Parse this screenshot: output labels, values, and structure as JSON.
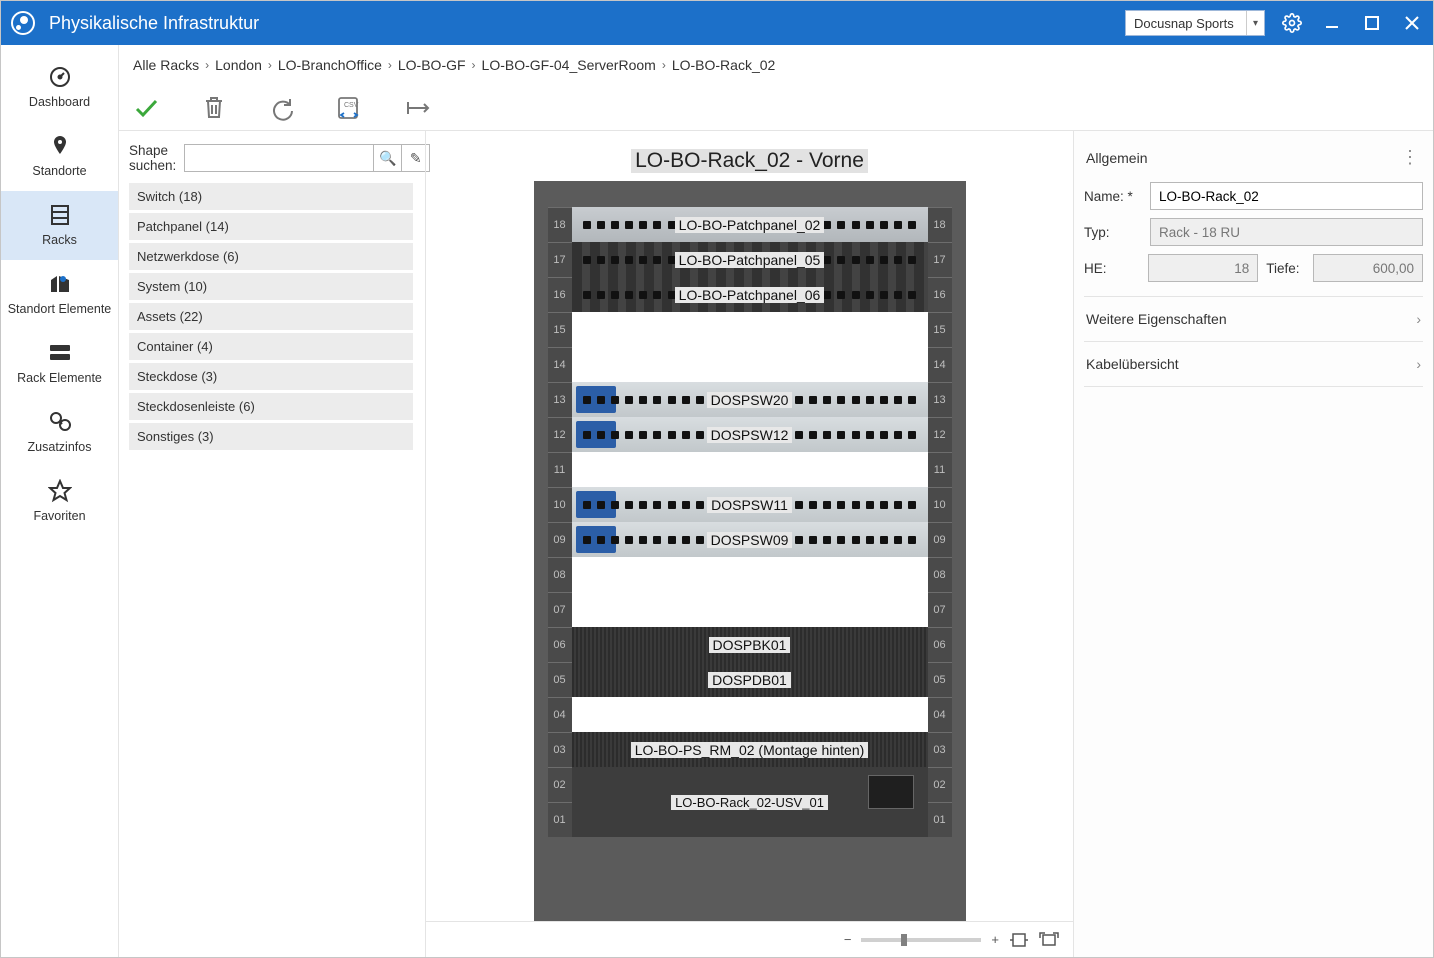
{
  "titlebar": {
    "app_title": "Physikalische Infrastruktur",
    "profile_name": "Docusnap Sports"
  },
  "left_nav": {
    "items": [
      {
        "label": "Dashboard"
      },
      {
        "label": "Standorte"
      },
      {
        "label": "Racks"
      },
      {
        "label": "Standort Elemente"
      },
      {
        "label": "Rack Elemente"
      },
      {
        "label": "Zusatzinfos"
      },
      {
        "label": "Favoriten"
      }
    ]
  },
  "breadcrumb": {
    "items": [
      "Alle Racks",
      "London",
      "LO-BranchOffice",
      "LO-BO-GF",
      "LO-BO-GF-04_ServerRoom",
      "LO-BO-Rack_02"
    ]
  },
  "shape_panel": {
    "search_label": "Shape suchen:",
    "search_value": "",
    "items": [
      "Switch (18)",
      "Patchpanel (14)",
      "Netzwerkdose (6)",
      "System (10)",
      "Assets (22)",
      "Container (4)",
      "Steckdose (3)",
      "Steckdosenleiste (6)",
      "Sonstiges (3)"
    ]
  },
  "rack_view": {
    "rack_title": "LO-BO-Rack_02 - Vorne",
    "units": [
      {
        "u": "18",
        "label": "LO-BO-Patchpanel_02",
        "style": "patch-grey"
      },
      {
        "u": "17",
        "label": "LO-BO-Patchpanel_05",
        "style": "patch-dark"
      },
      {
        "u": "16",
        "label": "LO-BO-Patchpanel_06",
        "style": "patch-dark"
      },
      {
        "u": "15",
        "label": "",
        "style": "empty"
      },
      {
        "u": "14",
        "label": "",
        "style": "empty"
      },
      {
        "u": "13",
        "label": "DOSPSW20",
        "style": "switch"
      },
      {
        "u": "12",
        "label": "DOSPSW12",
        "style": "switch"
      },
      {
        "u": "11",
        "label": "",
        "style": "empty"
      },
      {
        "u": "10",
        "label": "DOSPSW11",
        "style": "switch"
      },
      {
        "u": "09",
        "label": "DOSPSW09",
        "style": "switch"
      },
      {
        "u": "08",
        "label": "",
        "style": "empty"
      },
      {
        "u": "07",
        "label": "",
        "style": "empty"
      },
      {
        "u": "06",
        "label": "DOSPBK01",
        "style": "dark"
      },
      {
        "u": "05",
        "label": "DOSPDB01",
        "style": "dark"
      },
      {
        "u": "04",
        "label": "",
        "style": "empty"
      },
      {
        "u": "03",
        "label": "LO-BO-PS_RM_02 (Montage hinten)",
        "style": "dark"
      }
    ],
    "ups": {
      "u_top": "02",
      "u_bot": "01",
      "label": "LO-BO-Rack_02-USV_01"
    }
  },
  "right_panel": {
    "section_general": "Allgemein",
    "name_label": "Name: *",
    "name_value": "LO-BO-Rack_02",
    "type_label": "Typ:",
    "type_value": "Rack - 18 RU",
    "he_label": "HE:",
    "he_value": "18",
    "depth_label": "Tiefe:",
    "depth_value": "600,00",
    "acc1": "Weitere Eigenschaften",
    "acc2": "Kabelübersicht"
  }
}
